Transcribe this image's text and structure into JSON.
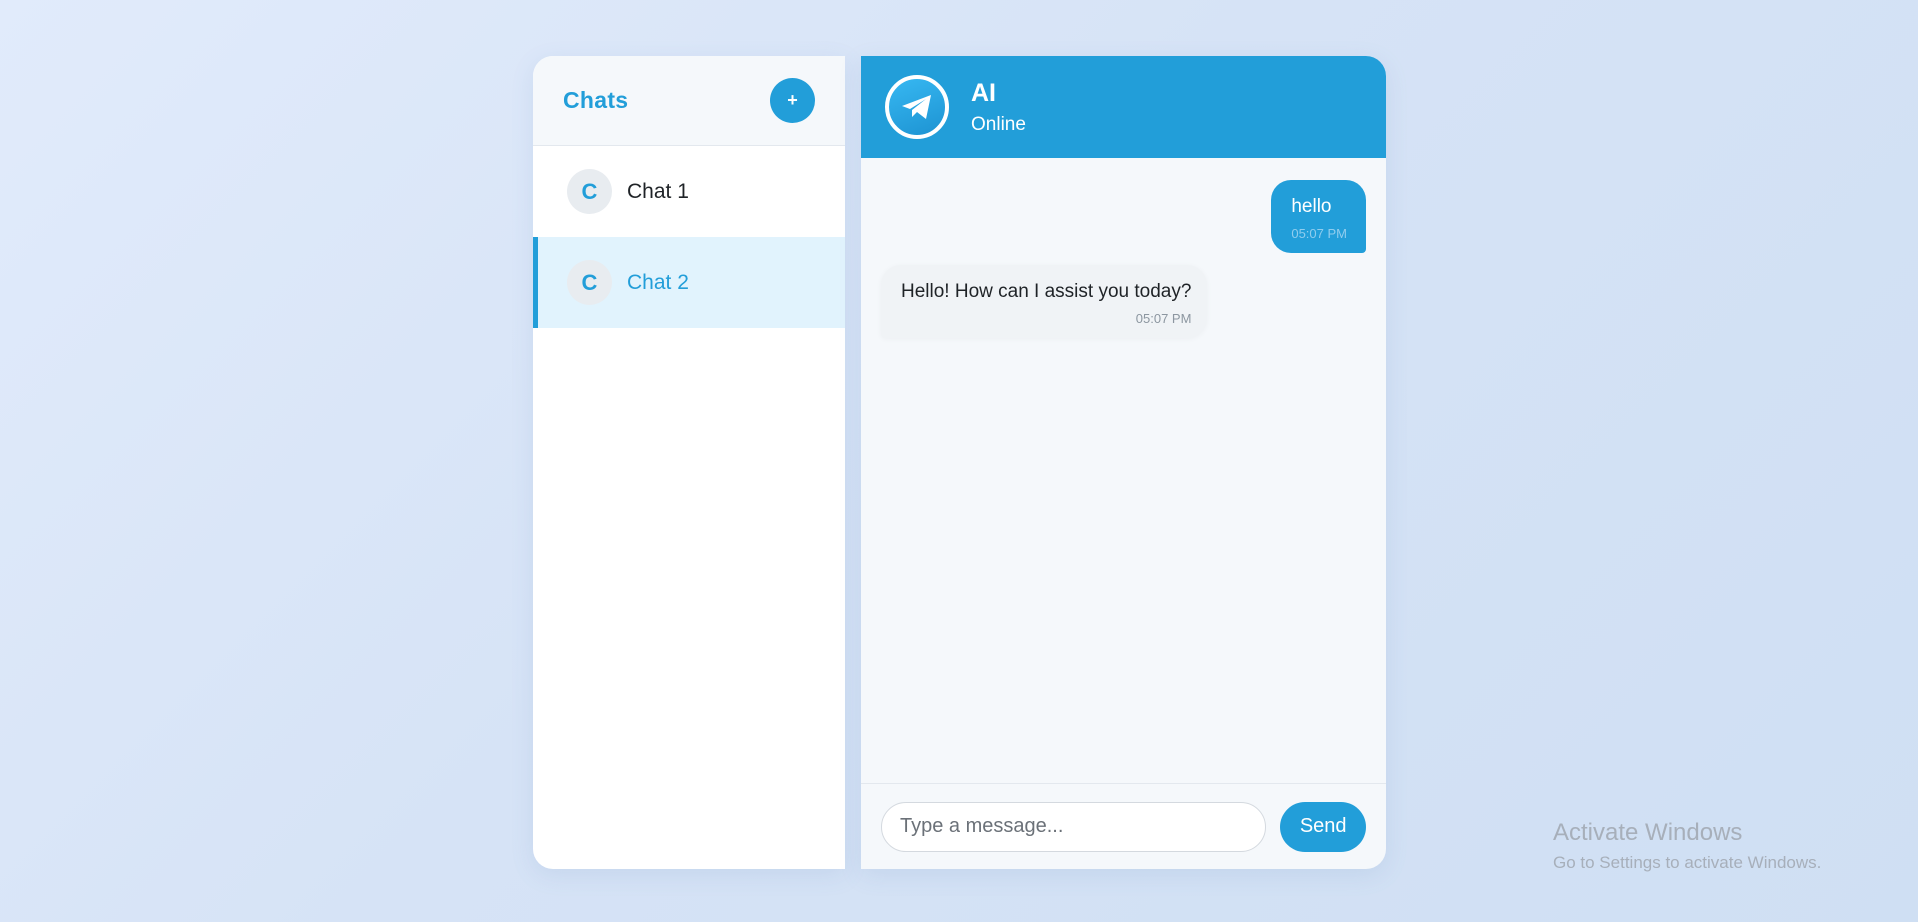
{
  "sidebar": {
    "title": "Chats",
    "new_chat_label": "+",
    "chats": [
      {
        "avatar": "C",
        "name": "Chat 1",
        "active": false
      },
      {
        "avatar": "C",
        "name": "Chat 2",
        "active": true
      }
    ]
  },
  "header": {
    "avatar_icon": "telegram-paper-plane-icon",
    "title": "AI",
    "status": "Online"
  },
  "messages": [
    {
      "direction": "outgoing",
      "text": "hello",
      "time": "05:07 PM"
    },
    {
      "direction": "incoming",
      "text": "Hello! How can I assist you today?",
      "time": "05:07 PM"
    }
  ],
  "composer": {
    "placeholder": "Type a message...",
    "value": "",
    "send_label": "Send"
  },
  "watermark": {
    "title": "Activate Windows",
    "subtitle": "Go to Settings to activate Windows."
  },
  "colors": {
    "accent": "#229ed9",
    "active_chat_bg": "#e1f3fd"
  }
}
